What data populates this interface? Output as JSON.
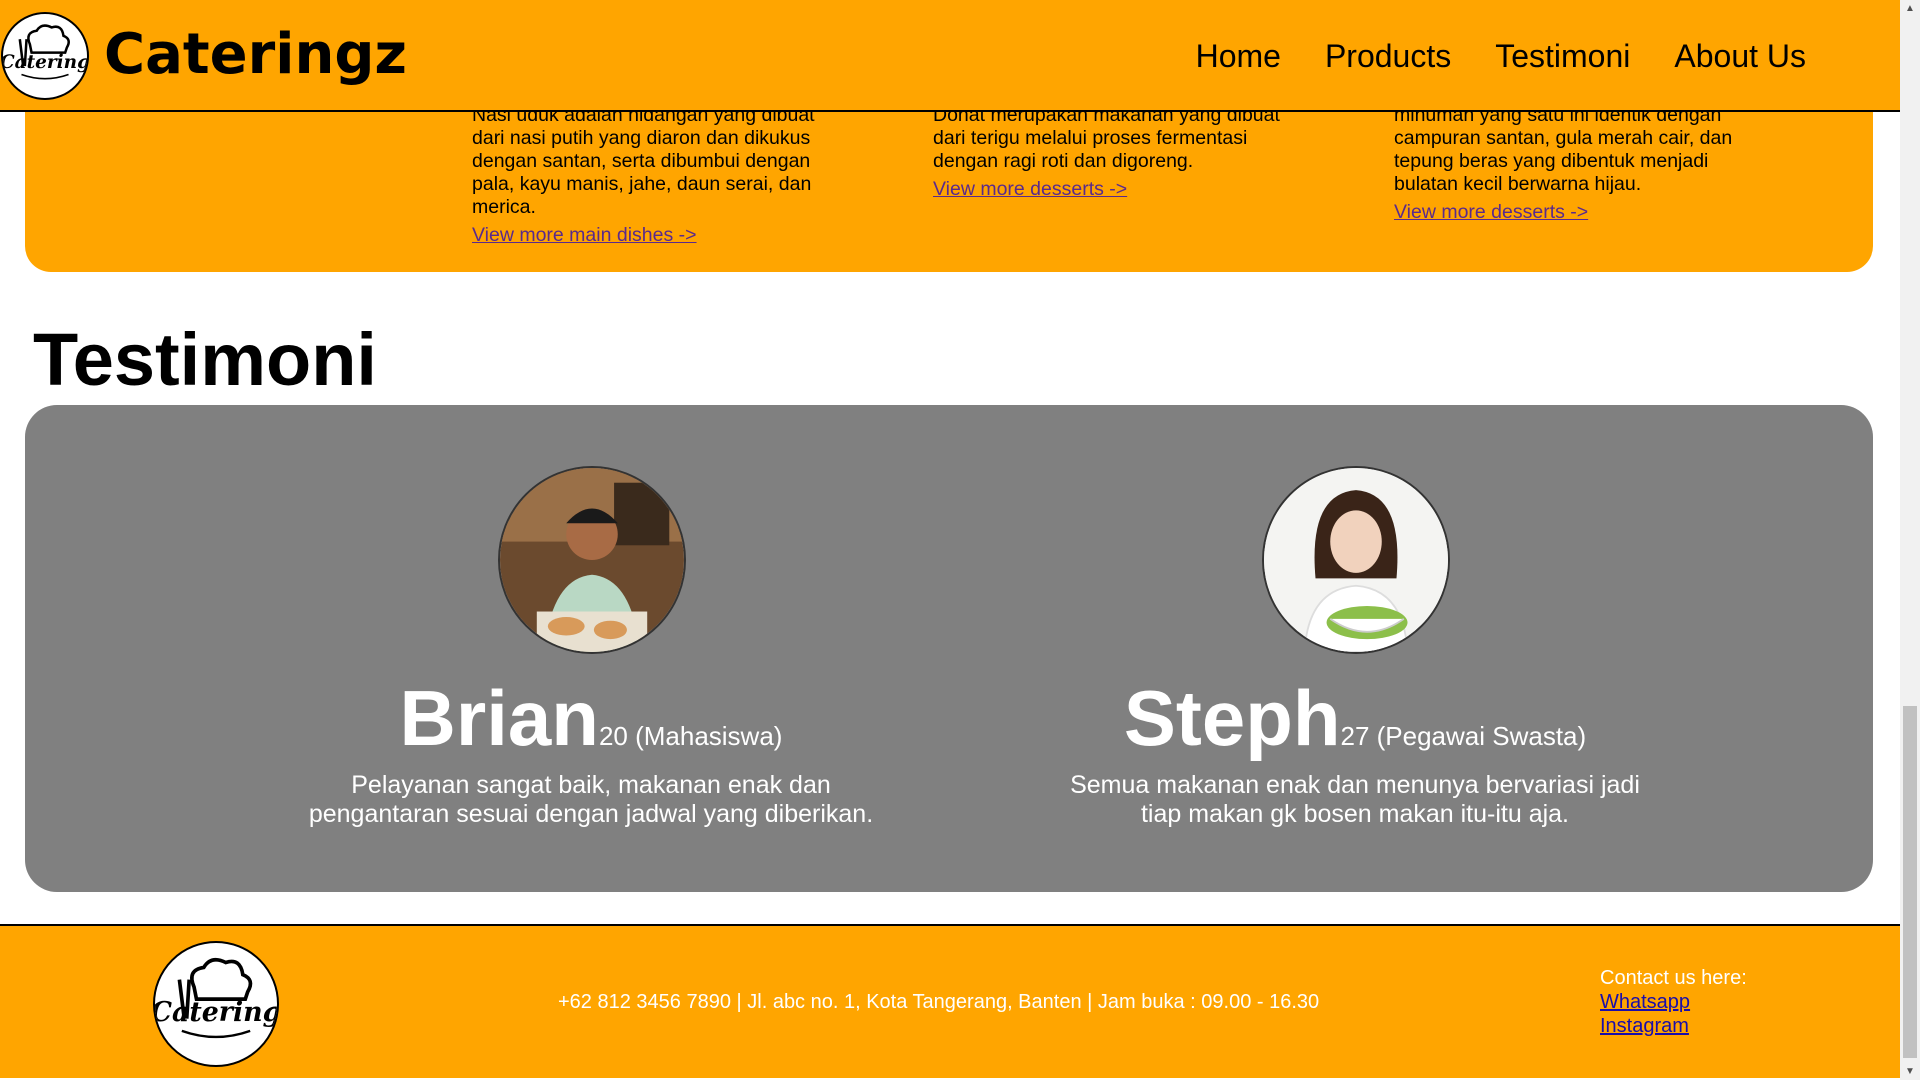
{
  "header": {
    "brand": "Cateringz",
    "logo_text": "Catering",
    "nav": [
      "Home",
      "Products",
      "Testimoni",
      "About Us"
    ]
  },
  "products": {
    "items": [
      {
        "lines": [
          "Nasi uduk adalah hidangan yang dibuat",
          "dari nasi putih yang diaron dan dikukus",
          "dengan santan, serta dibumbui dengan",
          "pala, kayu manis, jahe, daun serai, dan",
          "merica."
        ],
        "link": "View more main dishes ->"
      },
      {
        "lines": [
          "Donat merupakan makanan yang dibuat",
          "dari terigu melalui proses fermentasi",
          "dengan ragi roti dan digoreng."
        ],
        "link": "View more desserts ->"
      },
      {
        "lines": [
          "minuman yang satu ini identik dengan",
          "campuran santan, gula merah cair, dan",
          "tepung beras yang dibentuk menjadi",
          "bulatan kecil berwarna hijau."
        ],
        "link": "View more desserts ->"
      }
    ]
  },
  "testimoni": {
    "title": "Testimoni",
    "cards": [
      {
        "name": "Brian",
        "detail": "20 (Mahasiswa)",
        "quote_lines": [
          "Pelayanan sangat baik, makanan enak dan",
          "pengantaran sesuai dengan jadwal yang diberikan."
        ]
      },
      {
        "name": "Steph",
        "detail": "27 (Pegawai Swasta)",
        "quote_lines": [
          "Semua makanan enak dan menunya bervariasi jadi",
          "tiap makan gk bosen makan itu-itu aja."
        ]
      }
    ]
  },
  "footer": {
    "info": "+62 812 3456 7890 | Jl. abc no. 1, Kota Tangerang, Banten | Jam buka : 09.00 - 16.30",
    "contact_label": "Contact us here:",
    "links": [
      "Whatsapp",
      "Instagram"
    ]
  },
  "colors": {
    "accent": "#FFA500",
    "panel": "#808080"
  }
}
